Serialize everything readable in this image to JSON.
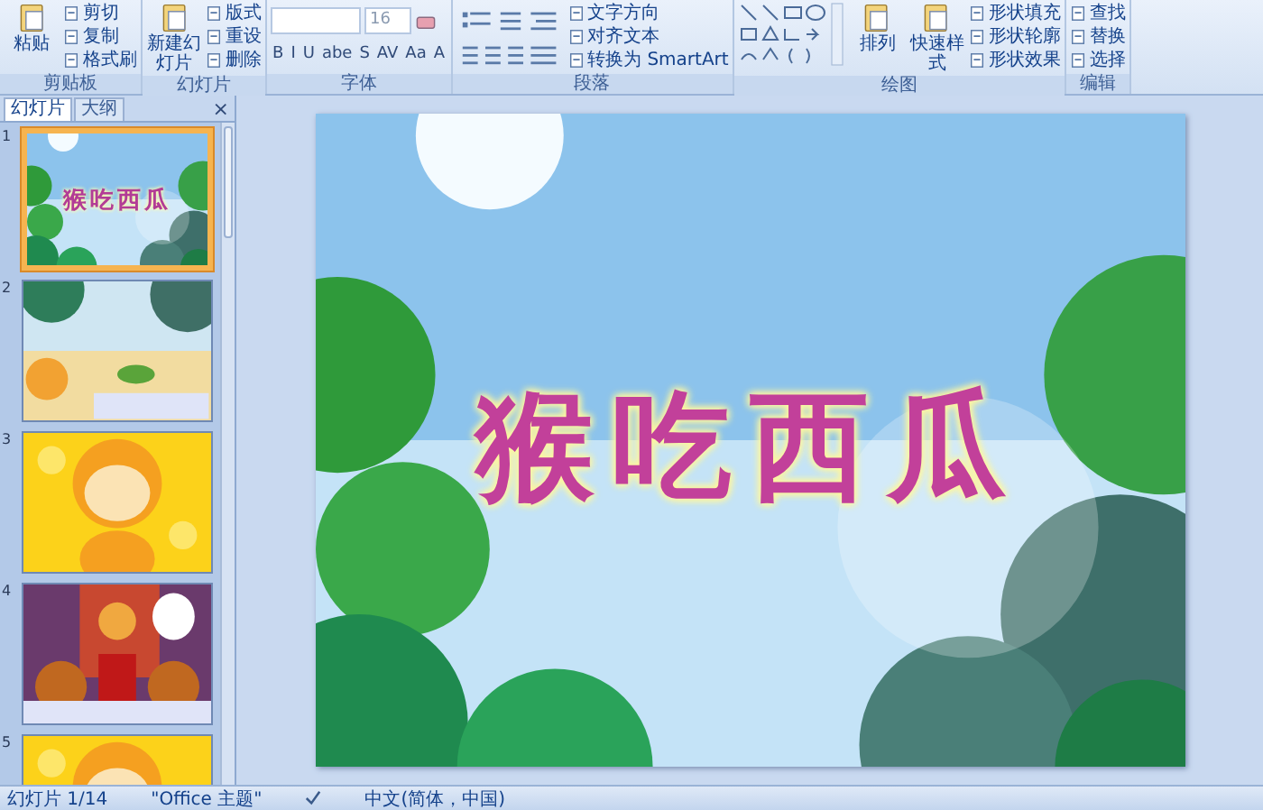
{
  "ribbon": {
    "groups": [
      {
        "kind": "clipboard",
        "label": "剪贴板",
        "large": [
          "粘贴"
        ],
        "small": [
          "剪切",
          "复制",
          "格式刷"
        ]
      },
      {
        "kind": "slides",
        "label": "幻灯片",
        "large": [
          "新建幻灯片"
        ],
        "small": [
          "版式",
          "重设",
          "删除"
        ]
      },
      {
        "kind": "font",
        "label": "字体",
        "font_size": "16",
        "styles": [
          "B",
          "I",
          "U",
          "abe",
          "S",
          "AV",
          "Aa",
          "A"
        ]
      },
      {
        "kind": "paragraph",
        "label": "段落",
        "small": [
          "文字方向",
          "对齐文本",
          "转换为 SmartArt"
        ]
      },
      {
        "kind": "drawing",
        "label": "绘图",
        "large": [
          "排列",
          "快速样式"
        ],
        "small": [
          "形状填充",
          "形状轮廓",
          "形状效果"
        ]
      },
      {
        "kind": "editing",
        "label": "编辑",
        "small": [
          "查找",
          "替换",
          "选择"
        ]
      }
    ]
  },
  "panel": {
    "tabs": [
      {
        "label": "幻灯片",
        "selected": true
      },
      {
        "label": "大纲",
        "selected": false
      }
    ],
    "close": "×",
    "thumbnails": [
      {
        "number": "1",
        "selected": true,
        "title": "猴吃西瓜"
      },
      {
        "number": "2",
        "selected": false
      },
      {
        "number": "3",
        "selected": false
      },
      {
        "number": "4",
        "selected": false
      },
      {
        "number": "5",
        "selected": false
      }
    ]
  },
  "slide": {
    "title": "猴吃西瓜"
  },
  "status_bar": {
    "slide": "幻灯片 1/14",
    "theme": "\"Office 主题\"",
    "language": "中文(简体，中国)"
  }
}
